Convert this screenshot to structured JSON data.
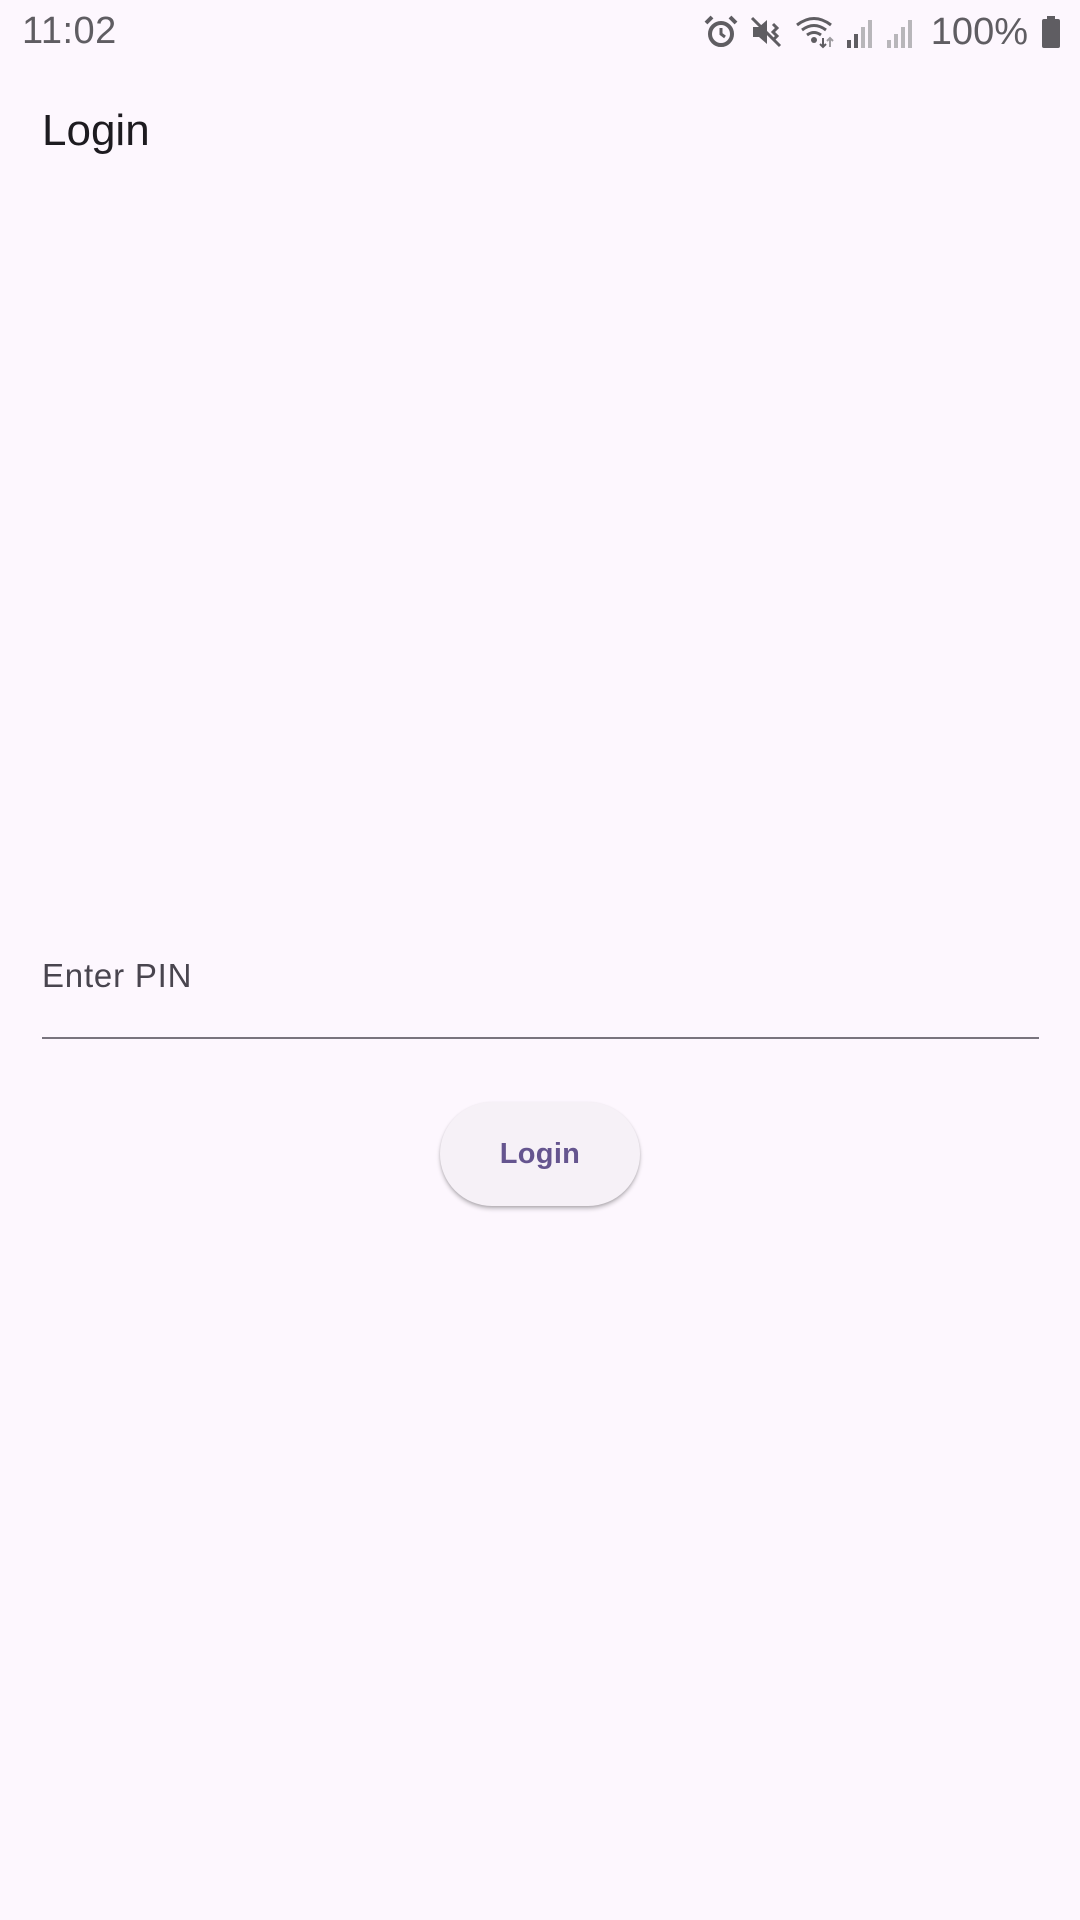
{
  "status_bar": {
    "time": "11:02",
    "icons": [
      "alarm-icon",
      "mute-icon",
      "wifi-icon",
      "signal-icon",
      "signal-icon",
      "battery-icon"
    ],
    "battery_level": "100%"
  },
  "app_bar": {
    "title": "Login"
  },
  "pin_field": {
    "label": "Enter PIN",
    "value": ""
  },
  "login_button": {
    "label": "Login"
  },
  "colors": {
    "background": "#fdf7fe",
    "primary": "#65558f",
    "on_surface": "#1d1b20",
    "on_surface_variant": "#49454f",
    "outline": "#79747e"
  }
}
